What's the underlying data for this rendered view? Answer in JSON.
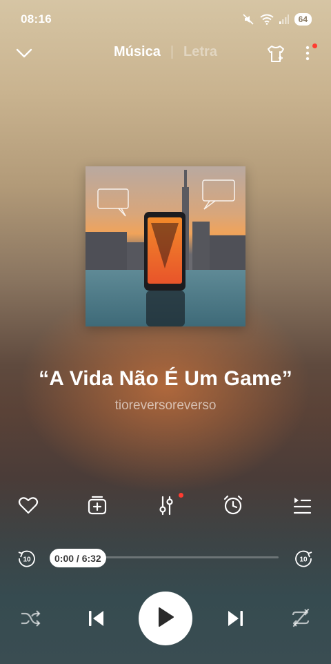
{
  "status_bar": {
    "time": "08:16",
    "battery_level": "64",
    "icons": [
      "mute-icon",
      "wifi-icon",
      "signal-icon",
      "battery-icon"
    ]
  },
  "header": {
    "tab_music": "Música",
    "tab_separator": "|",
    "tab_lyrics": "Letra",
    "active_tab": "Música",
    "icons": [
      "chevron-down-icon",
      "shirt-theme-icon",
      "more-vertical-icon"
    ]
  },
  "song": {
    "title": "“A Vida Não É Um Game”",
    "artist": "tioreversoreverso"
  },
  "actions": {
    "icons": [
      "heart-icon",
      "add-to-playlist-icon",
      "equalizer-icon",
      "alarm-clock-icon",
      "queue-icon"
    ]
  },
  "progress": {
    "time_label": "0:00 / 6:32",
    "fraction": 0.0,
    "rewind_seconds": "10",
    "forward_seconds": "10"
  },
  "controls": {
    "icons": [
      "shuffle-icon",
      "previous-icon",
      "play-icon",
      "next-icon",
      "repeat-off-icon"
    ]
  },
  "colors": {
    "accent": "#ffffff",
    "notification_dot": "#ff3b30"
  }
}
